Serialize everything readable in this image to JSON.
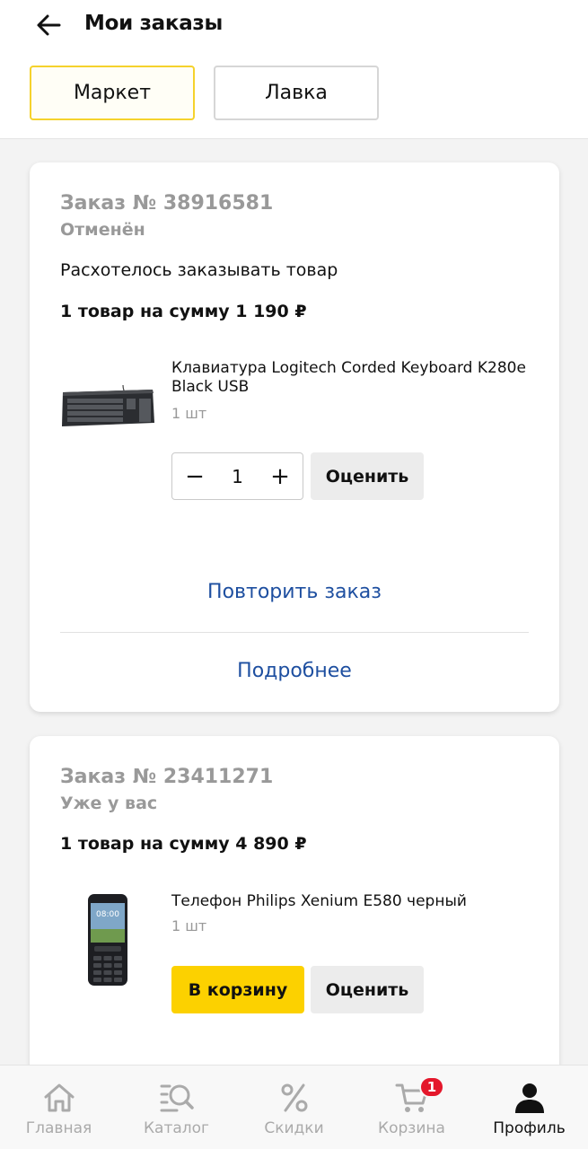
{
  "header": {
    "title": "Мои заказы",
    "segments": [
      "Маркет",
      "Лавка"
    ]
  },
  "orders": [
    {
      "number": "Заказ № 38916581",
      "status": "Отменён",
      "reason": "Расхотелось заказывать товар",
      "summary": "1 товар на сумму 1 190 ₽",
      "product": {
        "name": "Клавиатура Logitech Corded Keyboard K280e Black USB",
        "qty": "1 шт",
        "stepper_value": "1",
        "rate_label": "Оценить"
      },
      "repeat_label": "Повторить заказ",
      "details_label": "Подробнее"
    },
    {
      "number": "Заказ № 23411271",
      "status": "Уже у вас",
      "summary": "1 товар на сумму 4 890 ₽",
      "product": {
        "name": "Телефон Philips Xenium E580 черный",
        "qty": "1 шт",
        "cart_label": "В корзину",
        "rate_label": "Оценить",
        "screen_time": "08:00"
      }
    }
  ],
  "tabbar": {
    "items": [
      {
        "label": "Главная",
        "icon": "home-icon"
      },
      {
        "label": "Каталог",
        "icon": "catalog-search-icon"
      },
      {
        "label": "Скидки",
        "icon": "percent-icon"
      },
      {
        "label": "Корзина",
        "icon": "cart-icon",
        "badge": "1"
      },
      {
        "label": "Профиль",
        "icon": "profile-icon"
      }
    ],
    "active_index": 4
  },
  "colors": {
    "accent_yellow": "#fcd100",
    "link_blue": "#1e4fa0",
    "badge_red": "#e4172b"
  }
}
